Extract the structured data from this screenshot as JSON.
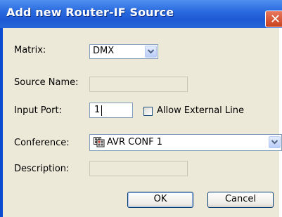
{
  "dialog": {
    "title": "Add new Router-IF Source",
    "close_glyph": "✕"
  },
  "form": {
    "matrix": {
      "label": "Matrix:",
      "value": "DMX"
    },
    "source_name": {
      "label": "Source Name:",
      "value": ""
    },
    "input_port": {
      "label": "Input Port:",
      "value": "1"
    },
    "allow_external": {
      "label": "Allow External Line",
      "checked": false
    },
    "conference": {
      "label": "Conference:",
      "value": "AVR CONF 1",
      "icon": "conference-icon"
    },
    "description": {
      "label": "Description:",
      "value": ""
    }
  },
  "buttons": {
    "ok_label": "OK",
    "cancel_label": "Cancel"
  },
  "colors": {
    "title_bar": "#2a6bdf",
    "dialog_face": "#ece9d8",
    "field_border": "#7f9db9",
    "close_button": "#c9421f"
  }
}
